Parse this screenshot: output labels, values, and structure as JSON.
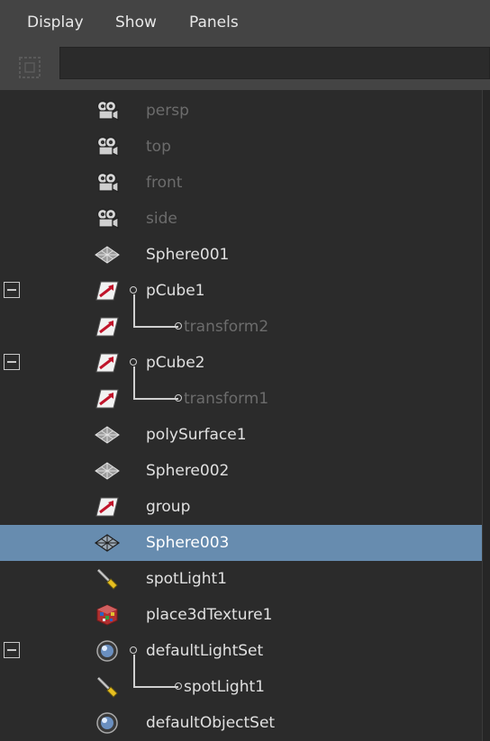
{
  "menubar": {
    "items": [
      {
        "label": "Display"
      },
      {
        "label": "Show"
      },
      {
        "label": "Panels"
      }
    ]
  },
  "outliner": {
    "rows": [
      {
        "label": "persp",
        "icon": "camera-icon",
        "dim": true
      },
      {
        "label": "top",
        "icon": "camera-icon",
        "dim": true
      },
      {
        "label": "front",
        "icon": "camera-icon",
        "dim": true
      },
      {
        "label": "side",
        "icon": "camera-icon",
        "dim": true
      },
      {
        "label": "Sphere001",
        "icon": "mesh-icon"
      },
      {
        "label": "pCube1",
        "icon": "transform-icon",
        "expanded": true
      },
      {
        "label": "transform2",
        "icon": "transform-icon",
        "dim": true,
        "child": true
      },
      {
        "label": "pCube2",
        "icon": "transform-icon",
        "expanded": true
      },
      {
        "label": "transform1",
        "icon": "transform-icon",
        "dim": true,
        "child": true
      },
      {
        "label": "polySurface1",
        "icon": "mesh-icon"
      },
      {
        "label": "Sphere002",
        "icon": "mesh-icon"
      },
      {
        "label": "group",
        "icon": "transform-icon"
      },
      {
        "label": "Sphere003",
        "icon": "mesh-icon",
        "selected": true
      },
      {
        "label": "spotLight1",
        "icon": "spotlight-icon"
      },
      {
        "label": "place3dTexture1",
        "icon": "texture-placement-icon"
      },
      {
        "label": "defaultLightSet",
        "icon": "set-icon",
        "expanded": true
      },
      {
        "label": "spotLight1",
        "icon": "spotlight-icon",
        "child": true
      },
      {
        "label": "defaultObjectSet",
        "icon": "set-icon"
      }
    ]
  },
  "colors": {
    "background": "#2b2b2b",
    "menubar": "#444444",
    "selection": "#678caf",
    "text": "#e0e0e0",
    "dim_text": "#6c6c6c"
  }
}
